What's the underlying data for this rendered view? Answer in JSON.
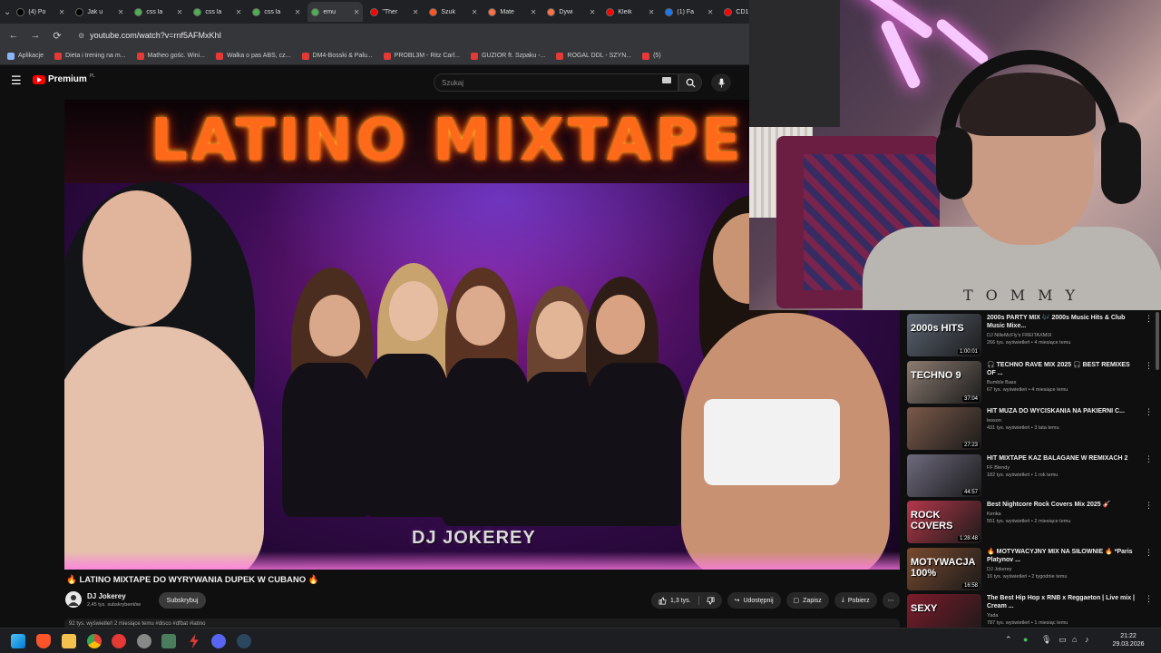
{
  "browser": {
    "tabs": [
      {
        "label": "(4) Po",
        "color": "#000000"
      },
      {
        "label": "Jak u",
        "color": "#000000"
      },
      {
        "label": "css la",
        "color": "#4caf50"
      },
      {
        "label": "css la",
        "color": "#4caf50"
      },
      {
        "label": "css la",
        "color": "#4caf50"
      },
      {
        "label": "emu",
        "color": "#4caf50"
      },
      {
        "label": "\"Ther",
        "color": "#ff0000"
      },
      {
        "label": "Szuk",
        "color": "#ff5722"
      },
      {
        "label": "Mate",
        "color": "#ff7043"
      },
      {
        "label": "Dywi",
        "color": "#ff7043"
      },
      {
        "label": "Kleik",
        "color": "#ff0000"
      },
      {
        "label": "(1) Fa",
        "color": "#1877f2"
      },
      {
        "label": "CD1",
        "color": "#ff0000"
      }
    ],
    "url": "youtube.com/watch?v=rnf5AFMxKhI",
    "bookmarks": [
      "Aplikacje",
      "Dieta i trening na m...",
      "Matheo gośc. Wini...",
      "Walka o pas ABS, cz...",
      "DM4-Bosski & Palu...",
      "PROBL3M - Ritz Carl...",
      "GUZIOR ft. Szpaku -...",
      "ROGAL DDL - SZYN...",
      "(5)"
    ]
  },
  "youtube": {
    "logo_word": "Premium",
    "logo_country": "PL",
    "search_placeholder": "Szukaj"
  },
  "video": {
    "banner_text": "LATINO MIXTAPE",
    "caption": "DJ JOKEREY"
  },
  "webcam": {
    "shirt_text": "TOMMY"
  },
  "watch": {
    "title": "🔥 LATINO MIXTAPE DO WYRYWANIA DUPEK W CUBANO 🔥",
    "channel": "DJ Jokerey",
    "subscribers": "2,45 tys. subskrybentów",
    "subscribe_label": "Subskrybuj",
    "likes": "1,3 tys.",
    "share_label": "Udostępnij",
    "save_label": "Zapisz",
    "download_label": "Pobierz",
    "views_line": "92 tys. wyświetleń  2 miesiące temu  #disco #dfbat #latino"
  },
  "related": [
    {
      "title": "2000s PARTY MIX 🎶 2000s Music Hits & Club Music Mixe...",
      "channel": "DJ NilleMcFly's FREITAXMIX",
      "stats": "266 tys. wyświetleń • 4 miesiące temu",
      "duration": "1:00:01",
      "thumb_text": "2000s HITS",
      "thumb_color": "#5b6472"
    },
    {
      "title": "🎧 TECHNO RAVE MIX 2025 🎧 BEST REMIXES OF ...",
      "channel": "Bumble Bass",
      "stats": "67 tys. wyświetleń • 4 miesiące temu",
      "duration": "37:04",
      "thumb_text": "TECHNO 9",
      "thumb_color": "#8c7c72"
    },
    {
      "title": "HIT MUZA DO WYCISKANIA NA PAKIERNI C...",
      "channel": "lesson",
      "stats": "431 tys. wyświetleń • 3 lata temu",
      "duration": "27:23",
      "thumb_text": "",
      "thumb_color": "#7b5a4a"
    },
    {
      "title": "HIT MIXTAPE KAZ BALAGANE W REMIXACH 2",
      "channel": "FF Blendy",
      "stats": "182 tys. wyświetleń • 1 rok temu",
      "duration": "44:57",
      "thumb_text": "",
      "thumb_color": "#6e6a7d"
    },
    {
      "title": "Best Nightcore Rock Covers Mix 2025 🎸",
      "channel": "Kenka",
      "stats": "551 tys. wyświetleń • 2 miesiące temu",
      "duration": "1:28:48",
      "thumb_text": "ROCK COVERS",
      "thumb_color": "#b4374a"
    },
    {
      "title": "🔥 MOTYWACYJNY MIX NA SIŁOWNIE 🔥 *Paris Platynov ...",
      "channel": "DJ Jokerey",
      "stats": "16 tys. wyświetleń • 2 tygodnie temu",
      "duration": "16:58",
      "thumb_text": "MOTYWACJA 100%",
      "thumb_color": "#7a4a2e"
    },
    {
      "title": "The Best Hip Hop x RNB x Reggaeton | Live mix | Cream ...",
      "channel": "Yada",
      "stats": "787 tys. wyświetleń • 1 miesiąc temu",
      "duration": "",
      "thumb_text": "SEXY",
      "thumb_color": "#7d1b2a"
    }
  ],
  "taskbar": {
    "time": "21:22",
    "date": "29.03.2026"
  }
}
